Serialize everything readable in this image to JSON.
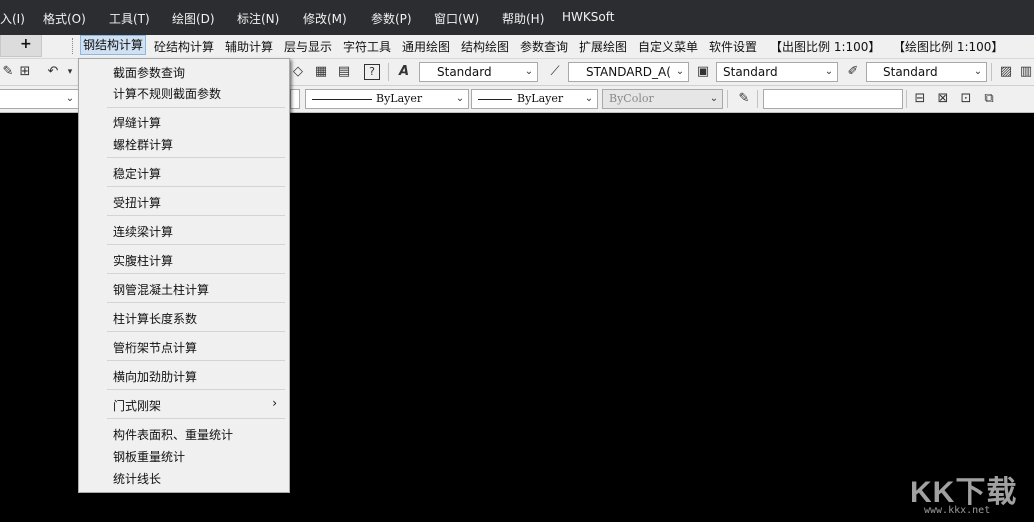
{
  "menubar": {
    "items": [
      "入(I)",
      "格式(O)",
      "工具(T)",
      "绘图(D)",
      "标注(N)",
      "修改(M)",
      "参数(P)",
      "窗口(W)",
      "帮助(H)",
      "HWKSoft"
    ]
  },
  "plugin_menu": {
    "tab_plus": "+",
    "items": [
      "钢结构计算",
      "砼结构计算",
      "辅助计算",
      "层与显示",
      "字符工具",
      "通用绘图",
      "结构绘图",
      "参数查询",
      "扩展绘图",
      "自定义菜单",
      "软件设置",
      "【出图比例 1:100】",
      "【绘图比例 1:100】"
    ]
  },
  "toolbar1": {
    "text_style": "Standard",
    "dim_style": "STANDARD_A(",
    "table_style": "Standard",
    "mleader_style": "Standard"
  },
  "toolbar2": {
    "linetype": "ByLayer",
    "lineweight": "ByLayer",
    "plot_style": "ByColor",
    "text_input_value": ""
  },
  "dropdown": {
    "items": [
      "截面参数查询",
      "计算不规则截面参数",
      "焊缝计算",
      "螺栓群计算",
      "稳定计算",
      "受扭计算",
      "连续梁计算",
      "实腹柱计算",
      "钢管混凝土柱计算",
      "柱计算长度系数",
      "管桁架节点计算",
      "横向加劲肋计算",
      "门式刚架",
      "构件表面积、重量统计",
      "钢板重量统计",
      "统计线长"
    ],
    "submenu_arrow": "›"
  },
  "watermark": {
    "brand": "KK下载",
    "url": "www.kkx.net"
  }
}
